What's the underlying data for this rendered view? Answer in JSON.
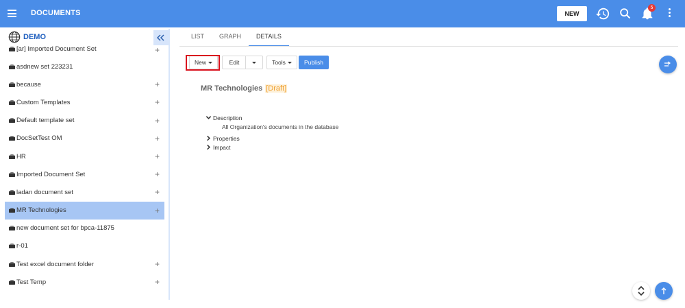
{
  "header": {
    "title": "DOCUMENTS",
    "new_label": "NEW",
    "notification_count": "5",
    "accent": "#4a8de8"
  },
  "sidebar": {
    "root_label": "DEMO",
    "items": [
      {
        "label": "[ar] Imported Document Set",
        "plus": "+"
      },
      {
        "label": "asdnew set 223231",
        "plus": ""
      },
      {
        "label": "because",
        "plus": "+"
      },
      {
        "label": "Custom Templates",
        "plus": "+"
      },
      {
        "label": "Default template set",
        "plus": "+"
      },
      {
        "label": "DocSetTest OM",
        "plus": "+"
      },
      {
        "label": "HR",
        "plus": "+"
      },
      {
        "label": "Imported Document Set",
        "plus": "+"
      },
      {
        "label": "ladan document set",
        "plus": "+"
      },
      {
        "label": "MR Technologies",
        "plus": "+"
      },
      {
        "label": "new document set for bpca-11875",
        "plus": ""
      },
      {
        "label": "r-01",
        "plus": ""
      },
      {
        "label": "Test excel document folder",
        "plus": "+"
      },
      {
        "label": "Test Temp",
        "plus": "+"
      }
    ],
    "selected": "MR Technologies"
  },
  "tabs": [
    {
      "label": "LIST"
    },
    {
      "label": "GRAPH"
    },
    {
      "label": "DETAILS"
    }
  ],
  "active_tab": "DETAILS",
  "toolbar": {
    "new_label": "New",
    "edit_label": "Edit",
    "tools_label": "Tools",
    "publish_label": "Publish"
  },
  "details": {
    "title": "MR Technologies",
    "status": "[Draft]",
    "sections": {
      "description_label": "Description",
      "description_text": "All Organization's documents in the database",
      "properties_label": "Properties",
      "impact_label": "Impact"
    }
  }
}
